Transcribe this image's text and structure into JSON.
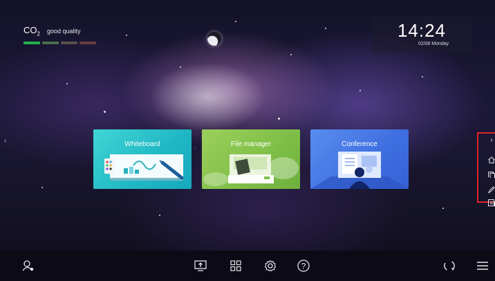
{
  "co2": {
    "label": "CO",
    "sub": "2",
    "status": "good quality",
    "level_segments": 1,
    "bar_colors": [
      "#22b14c",
      "#4a6f4c",
      "#5a5150",
      "#6a3c3e"
    ]
  },
  "clock": {
    "time": "14:24",
    "date": "02/08 Monday"
  },
  "apps": [
    {
      "label": "Whiteboard",
      "color": "#27c0cb"
    },
    {
      "label": "File manager",
      "color": "#86c34e"
    },
    {
      "label": "Conference",
      "color": "#4878e6"
    }
  ],
  "left_handle": {
    "glyph": "›"
  },
  "side_toolbar": {
    "highlight_color": "#e0242a",
    "items": [
      "chevron-right-icon",
      "home-icon",
      "window-icon",
      "pen-icon",
      "screenshot-icon"
    ],
    "expand_glyph": "›"
  },
  "bottom_bar": {
    "icons": [
      "user-settings-icon",
      "screen-share-icon",
      "apps-grid-icon",
      "settings-gear-icon",
      "help-icon",
      "refresh-icon",
      "menu-icon"
    ],
    "help_glyph": "?"
  }
}
